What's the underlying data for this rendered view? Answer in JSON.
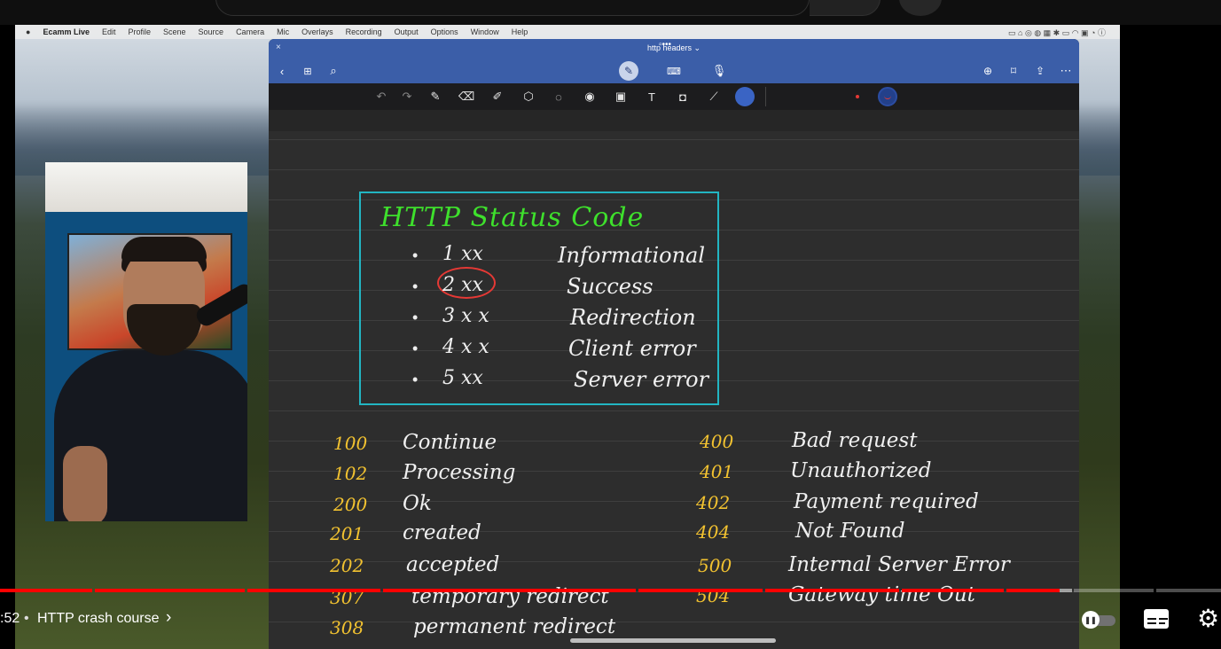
{
  "player": {
    "time_label": ":52",
    "separator": "•",
    "chapter_title": "HTTP crash course",
    "accent_color": "#ff0000",
    "progress_fraction": 0.868
  },
  "menubar": {
    "app": "Ecamm Live",
    "items": [
      "Edit",
      "Profile",
      "Scene",
      "Source",
      "Camera",
      "Mic",
      "Overlays",
      "Recording",
      "Output",
      "Options",
      "Window",
      "Help"
    ]
  },
  "notes_app": {
    "document_title": "http headers",
    "close": "×",
    "toolbar_icons": [
      "back-icon",
      "grid-icon",
      "search-icon",
      "pen-mode-icon",
      "keyboard-icon",
      "mic-icon",
      "new-page-icon",
      "bookmark-icon",
      "share-icon",
      "more-icon"
    ],
    "drawing_tools": [
      "undo-icon",
      "redo-icon",
      "pen-icon",
      "eraser-icon",
      "highlighter-icon",
      "shapes-icon",
      "lasso-icon",
      "laser-icon",
      "image-icon",
      "text-icon",
      "camera-icon",
      "ruler-icon",
      "selection-icon"
    ]
  },
  "notes": {
    "box_title": "HTTP Status Code",
    "categories": [
      {
        "bullet": "•",
        "code": "1 xx",
        "meaning": "Informational"
      },
      {
        "bullet": "•",
        "code": "2 xx",
        "meaning": "Success"
      },
      {
        "bullet": "•",
        "code": "3 x x",
        "meaning": "Redirection"
      },
      {
        "bullet": "•",
        "code": "4 x x",
        "meaning": "Client error"
      },
      {
        "bullet": "•",
        "code": "5 xx",
        "meaning": "Server error"
      }
    ],
    "left_codes": [
      {
        "code": "100",
        "text": "Continue"
      },
      {
        "code": "102",
        "text": "Processing"
      },
      {
        "code": "200",
        "text": "Ok"
      },
      {
        "code": "201",
        "text": "created"
      },
      {
        "code": "202",
        "text": "accepted"
      },
      {
        "code": "307",
        "text": "temporary redirect"
      },
      {
        "code": "308",
        "text": "permanent redirect"
      }
    ],
    "right_codes": [
      {
        "code": "400",
        "text": "Bad request"
      },
      {
        "code": "401",
        "text": "Unauthorized"
      },
      {
        "code": "402",
        "text": "Payment required"
      },
      {
        "code": "404",
        "text": "Not Found"
      },
      {
        "code": "500",
        "text": "Internal Server Error"
      },
      {
        "code": "504",
        "text": "Gateway time Out"
      }
    ],
    "colors": {
      "title": "#3ee02c",
      "box_border": "#22b5c2",
      "codes": "#f2c230",
      "highlight_circle": "#e53935"
    }
  }
}
